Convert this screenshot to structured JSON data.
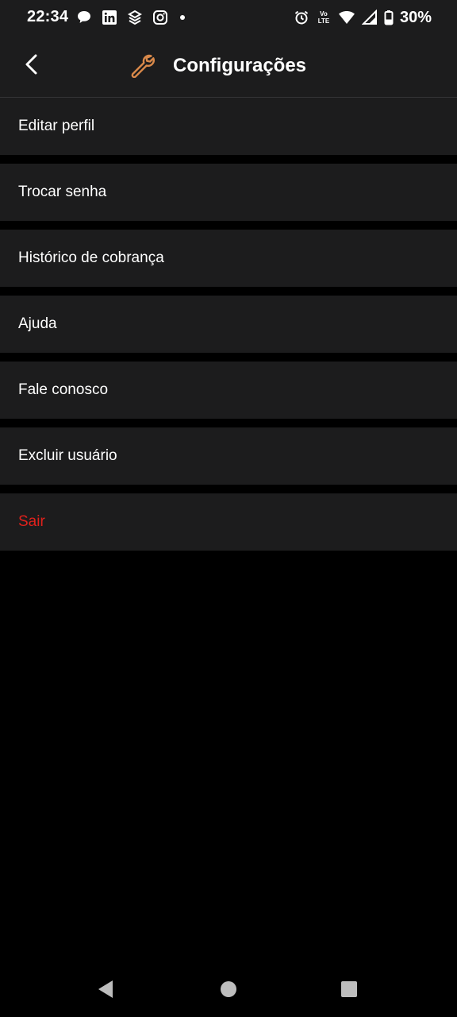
{
  "status_bar": {
    "time": "22:34",
    "battery_percent": "30%",
    "left_icons": [
      "chat-bubble-icon",
      "linkedin-icon",
      "stack-icon",
      "instagram-icon",
      "dot-icon"
    ],
    "right_icons": [
      "alarm-icon",
      "volte-icon",
      "wifi-icon",
      "signal-icon",
      "battery-icon"
    ],
    "volte_text": "Vo LTE"
  },
  "header": {
    "title": "Configurações",
    "icon": "wrench-icon",
    "back_icon": "chevron-left-icon"
  },
  "menu": {
    "items": [
      {
        "label": "Editar perfil"
      },
      {
        "label": "Trocar senha"
      },
      {
        "label": "Histórico de cobrança"
      },
      {
        "label": "Ajuda"
      },
      {
        "label": "Fale conosco"
      },
      {
        "label": "Excluir usuário"
      },
      {
        "label": "Sair"
      }
    ]
  },
  "nav_bar": {
    "icons": [
      "back-triangle-icon",
      "home-circle-icon",
      "recents-square-icon"
    ]
  },
  "colors": {
    "background": "#000000",
    "surface": "#1c1c1d",
    "accent_wrench": "#d9894a",
    "danger": "#e0211c",
    "text": "#ffffff"
  }
}
